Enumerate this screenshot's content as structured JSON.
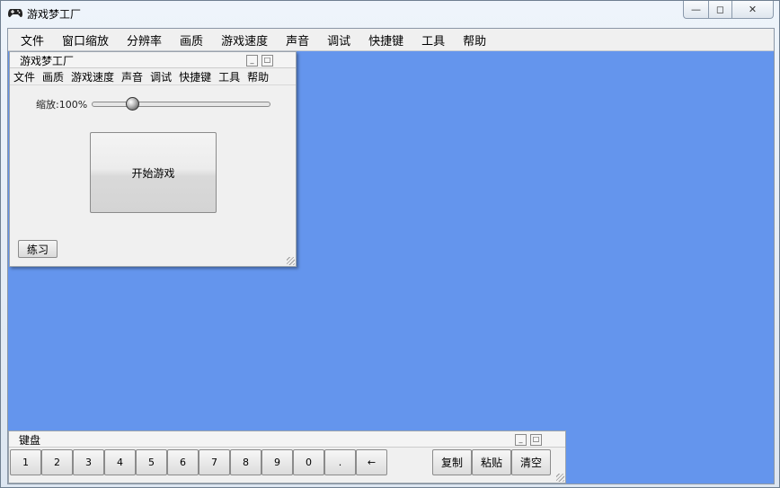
{
  "window": {
    "title": "游戏梦工厂",
    "caption_min": "—",
    "caption_max": "◻",
    "caption_close": "✕"
  },
  "menu": [
    "文件",
    "窗口缩放",
    "分辨率",
    "画质",
    "游戏速度",
    "声音",
    "调试",
    "快捷键",
    "工具",
    "帮助"
  ],
  "game_panel": {
    "title": "游戏梦工厂",
    "menu": [
      "文件",
      "画质",
      "游戏速度",
      "声音",
      "调试",
      "快捷键",
      "工具",
      "帮助"
    ],
    "zoom_label": "缩放:100%",
    "zoom_level": 0.2,
    "start_button": "开始游戏",
    "practice_button": "练习",
    "min_btn": "_",
    "max_btn": "□"
  },
  "keyboard_panel": {
    "title": "键盘",
    "keys": [
      "1",
      "2",
      "3",
      "4",
      "5",
      "6",
      "7",
      "8",
      "9",
      "0",
      ".",
      "←"
    ],
    "copy_button": "复制",
    "paste_button": "粘贴",
    "clear_button": "清空",
    "min_btn": "_",
    "max_btn": "□"
  },
  "colors": {
    "canvas": "#6495ed",
    "panel_bg": "#f0f0f0"
  }
}
